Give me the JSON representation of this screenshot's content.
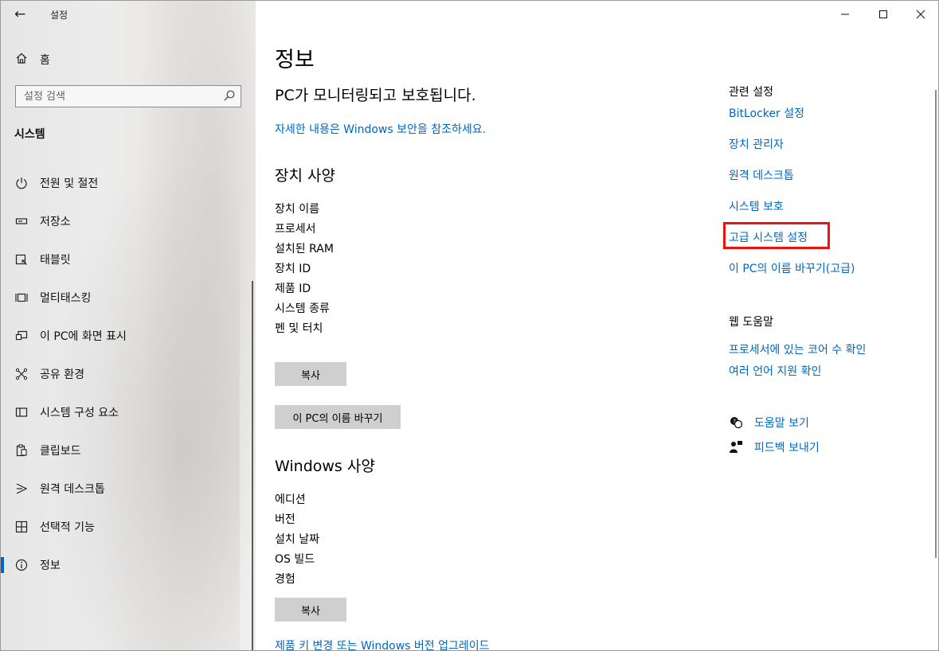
{
  "window": {
    "title": "설정",
    "back_label": "←",
    "controls": {
      "minimize": "—",
      "maximize": "☐",
      "close": "✕"
    }
  },
  "sidebar": {
    "home_label": "홈",
    "search_placeholder": "설정 검색",
    "section_title": "시스템",
    "items": [
      {
        "label": "전원 및 절전",
        "icon": "power-icon"
      },
      {
        "label": "저장소",
        "icon": "storage-icon"
      },
      {
        "label": "태블릿",
        "icon": "tablet-icon"
      },
      {
        "label": "멀티태스킹",
        "icon": "multitasking-icon"
      },
      {
        "label": "이 PC에 화면 표시",
        "icon": "project-icon"
      },
      {
        "label": "공유 환경",
        "icon": "share-icon"
      },
      {
        "label": "시스템 구성 요소",
        "icon": "components-icon"
      },
      {
        "label": "클립보드",
        "icon": "clipboard-icon"
      },
      {
        "label": "원격 데스크톱",
        "icon": "remote-desktop-icon"
      },
      {
        "label": "선택적 기능",
        "icon": "optional-features-icon"
      },
      {
        "label": "정보",
        "icon": "info-icon",
        "active": true
      }
    ]
  },
  "main": {
    "title": "정보",
    "status": "PC가 모니터링되고 보호됩니다.",
    "security_link": "자세한 내용은 Windows 보안을 참조하세요.",
    "device_specs": {
      "heading": "장치 사양",
      "labels": [
        "장치 이름",
        "프로세서",
        "설치된 RAM",
        "장치 ID",
        "제품 ID",
        "시스템 종류",
        "펜 및 터치"
      ],
      "copy_button": "복사",
      "rename_button": "이 PC의 이름 바꾸기"
    },
    "windows_specs": {
      "heading": "Windows 사양",
      "labels": [
        "에디션",
        "버전",
        "설치 날짜",
        "OS 빌드",
        "경험"
      ],
      "copy_button": "복사"
    },
    "upgrade_link": "제품 키 변경 또는 Windows 버전 업그레이드"
  },
  "related": {
    "heading": "관련 설정",
    "links": [
      "BitLocker 설정",
      "장치 관리자",
      "원격 데스크톱",
      "시스템 보호",
      "고급 시스템 설정",
      "이 PC의 이름 바꾸기(고급)"
    ],
    "highlighted": "고급 시스템 설정"
  },
  "web_help": {
    "heading": "웹 도움말",
    "links": [
      "프로세서에 있는 코어 수 확인",
      "여러 언어 지원 확인"
    ]
  },
  "help": {
    "get_help": "도움말 보기",
    "feedback": "피드백 보내기"
  },
  "colors": {
    "link": "#0067c0",
    "accent": "#0067c0",
    "highlight": "#ee1111",
    "button": "#cfcfcf"
  }
}
